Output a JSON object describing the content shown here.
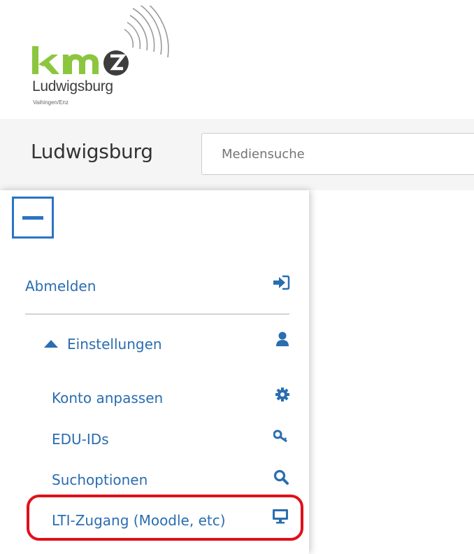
{
  "logo": {
    "letters": "kmz",
    "city": "Ludwigsburg",
    "sub": "Vaihingen/Enz",
    "colors": {
      "green": "#8cc63e",
      "dark": "#3d3d3d"
    }
  },
  "header": {
    "title": "Ludwigsburg",
    "search_placeholder": "Mediensuche"
  },
  "menu": {
    "toggle_icon": "minus-icon",
    "logout": {
      "label": "Abmelden",
      "icon": "sign-in-icon"
    },
    "settings": {
      "label": "Einstellungen",
      "icon": "user-icon",
      "caret": "caret-up-icon"
    },
    "items": [
      {
        "label": "Konto anpassen",
        "icon": "gear-icon"
      },
      {
        "label": "EDU-IDs",
        "icon": "key-icon"
      },
      {
        "label": "Suchoptionen",
        "icon": "search-icon"
      },
      {
        "label": "LTI-Zugang (Moodle, etc)",
        "icon": "desktop-icon"
      }
    ]
  },
  "colors": {
    "link": "#2a6db0",
    "accent": "#2a74c4",
    "highlight": "#e0101a",
    "bar": "#f5f5f5"
  }
}
